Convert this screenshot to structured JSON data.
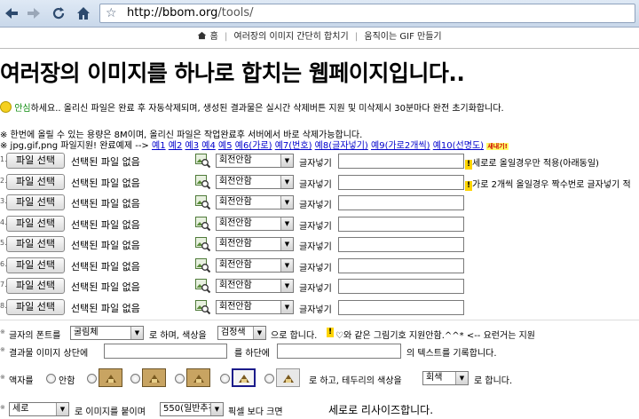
{
  "browser": {
    "url_host": "http://bbom.org",
    "url_path": "/tools/"
  },
  "topnav": {
    "home": "홈",
    "sep": "|",
    "merge": "여러장의 이미지 간단히 합치기",
    "gif": "움직이는 GIF 만들기"
  },
  "page": {
    "title": "여러장의 이미지를 하나로 합치는 웹페이지입니다..",
    "greeting_highlight": "안심",
    "greeting_rest": "하세요.. 올리신 파일은 완료 후 자동삭제되며, 생성된 결과물은 실시간 삭제버튼 지원 및 미삭제시 30분마다 완전 초기화합니다.",
    "limit_note": "※ 한번에 올릴 수 있는 용량은 8M이며, 올리신 파일은 작업완료후 서버에서 바로 삭제가능합니다.",
    "formats_note": "※ jpg,gif,png 파일지원! 완료예제 -->",
    "examples": [
      "예1",
      "예2",
      "예3",
      "예4",
      "예5",
      "예6(가로)",
      "예7(번호)",
      "예8(글자넣기)",
      "예9(가로2개씩)",
      "예10(선명도)"
    ],
    "new_badge": "새내기!"
  },
  "file_rows": [
    {
      "num": "1.",
      "button": "파일 선택",
      "status": "선택된 파일 없음",
      "rotate": "회전안함",
      "caption_label": "글자넣기",
      "caption": "",
      "note": "세로로 올일경우만 적용(아래동일)"
    },
    {
      "num": "2.",
      "button": "파일 선택",
      "status": "선택된 파일 없음",
      "rotate": "회전안함",
      "caption_label": "글자넣기",
      "caption": "",
      "note": "가로 2개씩 올일경우 짝수번로 글자넣기 적"
    },
    {
      "num": "3.",
      "button": "파일 선택",
      "status": "선택된 파일 없음",
      "rotate": "회전안함",
      "caption_label": "글자넣기",
      "caption": "",
      "note": ""
    },
    {
      "num": "4.",
      "button": "파일 선택",
      "status": "선택된 파일 없음",
      "rotate": "회전안함",
      "caption_label": "글자넣기",
      "caption": "",
      "note": ""
    },
    {
      "num": "5.",
      "button": "파일 선택",
      "status": "선택된 파일 없음",
      "rotate": "회전안함",
      "caption_label": "글자넣기",
      "caption": "",
      "note": ""
    },
    {
      "num": "6.",
      "button": "파일 선택",
      "status": "선택된 파일 없음",
      "rotate": "회전안함",
      "caption_label": "글자넣기",
      "caption": "",
      "note": ""
    },
    {
      "num": "7.",
      "button": "파일 선택",
      "status": "선택된 파일 없음",
      "rotate": "회전안함",
      "caption_label": "글자넣기",
      "caption": "",
      "note": ""
    },
    {
      "num": "8.",
      "button": "파일 선택",
      "status": "선택된 파일 없음",
      "rotate": "회전안함",
      "caption_label": "글자넣기",
      "caption": "",
      "note": ""
    }
  ],
  "options": {
    "font_label_a": "글자의 폰트를",
    "font_value": "굴림체",
    "font_label_b": "로 하며, 색상을",
    "color_value": "검정색",
    "font_label_c": "으로 합니다.",
    "tip": "♡와 같은 그림기호 지원안함.^^* <-- 요런거는 지원",
    "caption_label_a": "결과물 이미지 상단에",
    "caption_label_b": "를 하단에",
    "caption_label_c": "의 텍스트를 기록합니다.",
    "frame_label": "액자를",
    "frame_none": "안함",
    "frame_label_b": "로 하고, 테두리의 색상을",
    "border_color": "회색",
    "frame_label_c": "로 합니다.",
    "layout_value": "세로",
    "resize_label_a": "로 이미지를 붙이며",
    "resize_value": "550(일반추천)",
    "resize_label_b": "픽셀 보다 크면",
    "resize_label_c": "세로로 리사이즈합니다."
  },
  "colors": {
    "link": "#0000cc",
    "highlight_green": "#0a8a0a",
    "chrome": "#dfe9f5"
  }
}
